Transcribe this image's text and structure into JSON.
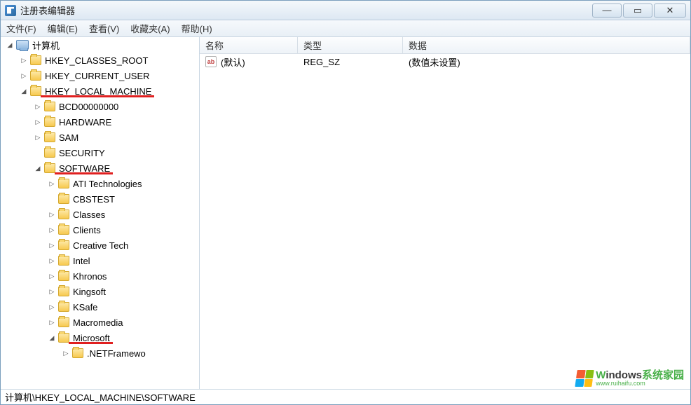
{
  "window": {
    "title": "注册表编辑器"
  },
  "menu": {
    "file": "文件(F)",
    "edit": "编辑(E)",
    "view": "查看(V)",
    "favorites": "收藏夹(A)",
    "help": "帮助(H)"
  },
  "tree": {
    "root": "计算机",
    "hkcr": "HKEY_CLASSES_ROOT",
    "hkcu": "HKEY_CURRENT_USER",
    "hklm": "HKEY_LOCAL_MACHINE",
    "hklm_children": {
      "bcd": "BCD00000000",
      "hardware": "HARDWARE",
      "sam": "SAM",
      "security": "SECURITY",
      "software": "SOFTWARE"
    },
    "software_children": {
      "ati": "ATI Technologies",
      "cbstest": "CBSTEST",
      "classes": "Classes",
      "clients": "Clients",
      "creative": "Creative Tech",
      "intel": "Intel",
      "khronos": "Khronos",
      "kingsoft": "Kingsoft",
      "ksafe": "KSafe",
      "macromedia": "Macromedia",
      "microsoft": "Microsoft"
    },
    "microsoft_children": {
      "netfx": ".NETFramewo"
    }
  },
  "list": {
    "headers": {
      "name": "名称",
      "type": "类型",
      "data": "数据"
    },
    "rows": [
      {
        "name": "(默认)",
        "type": "REG_SZ",
        "data": "(数值未设置)"
      }
    ]
  },
  "statusbar": "计算机\\HKEY_LOCAL_MACHINE\\SOFTWARE",
  "watermark": {
    "text_main_w": "W",
    "text_main_mid": "indows",
    "text_main_cn": "系统家园",
    "text_sub": "www.ruihaifu.com"
  }
}
